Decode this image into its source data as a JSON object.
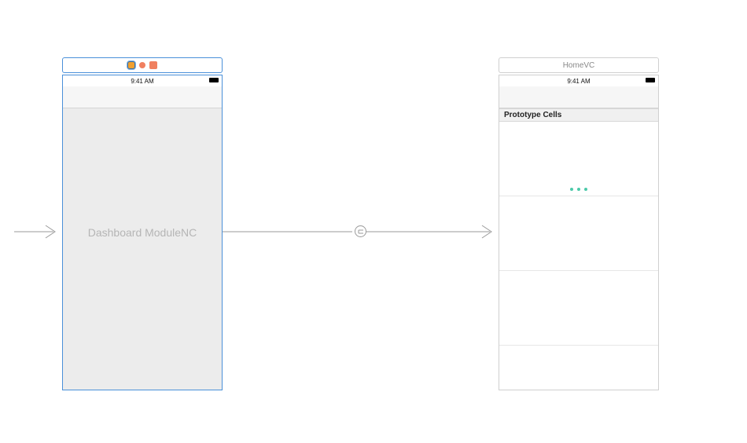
{
  "scene1": {
    "time": "9:41 AM",
    "placeholder": "Dashboard ModuleNC"
  },
  "scene2": {
    "title": "HomeVC",
    "time": "9:41 AM",
    "section_label": "Prototype Cells"
  }
}
